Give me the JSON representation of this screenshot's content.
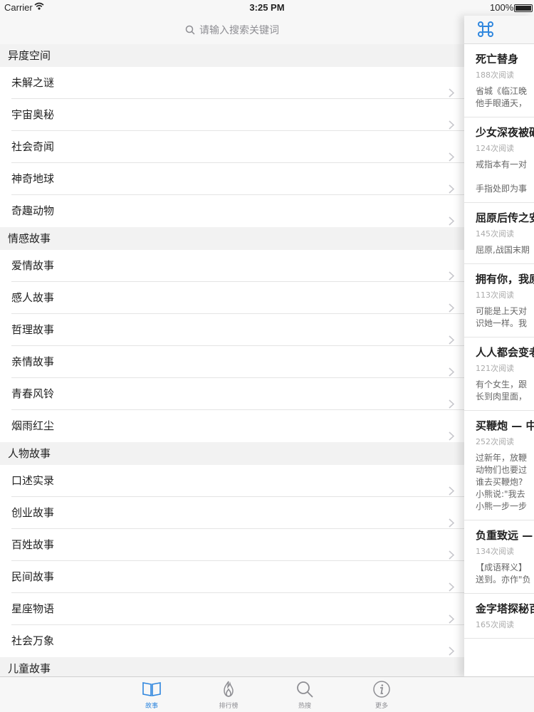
{
  "status_bar": {
    "carrier": "Carrier",
    "time": "3:25 PM",
    "battery": "100%"
  },
  "search": {
    "placeholder": "请输入搜索关键词"
  },
  "sections": [
    {
      "title": "异度空间",
      "items": [
        "未解之谜",
        "宇宙奥秘",
        "社会奇闻",
        "神奇地球",
        "奇趣动物"
      ]
    },
    {
      "title": "情感故事",
      "items": [
        "爱情故事",
        "感人故事",
        "哲理故事",
        "亲情故事",
        "青春风铃",
        "烟雨红尘"
      ]
    },
    {
      "title": "人物故事",
      "items": [
        "口述实录",
        "创业故事",
        "百姓故事",
        "民间故事",
        "星座物语",
        "社会万象"
      ]
    },
    {
      "title": "儿童故事",
      "items": []
    }
  ],
  "articles": [
    {
      "title": "死亡替身",
      "reads": "188次阅读",
      "excerpt": [
        "省城《临江晚",
        "他手眼通天，"
      ]
    },
    {
      "title": "少女深夜被砸",
      "reads": "124次阅读",
      "excerpt": [
        "戒指本有一对",
        "",
        "手指处即为事"
      ]
    },
    {
      "title": "屈原后传之安",
      "reads": "145次阅读",
      "excerpt": [
        "屈原,战国末期"
      ]
    },
    {
      "title": "拥有你，我原",
      "reads": "113次阅读",
      "excerpt": [
        "可能是上天对",
        "识她一样。我"
      ]
    },
    {
      "title": "人人都会变老",
      "reads": "121次阅读",
      "excerpt": [
        "有个女生，跟",
        "长到肉里面，"
      ]
    },
    {
      "title": "买鞭炮 — 中",
      "reads": "252次阅读",
      "excerpt": [
        "过新年，放鞭",
        "动物们也要过",
        "谁去买鞭炮?",
        "小熊说:\"我去",
        "小熊一步一步"
      ]
    },
    {
      "title": "负重致远 —",
      "reads": "134次阅读",
      "excerpt": [
        "【成语释义】",
        "送到。亦作\"负"
      ]
    },
    {
      "title": "金字塔探秘百",
      "reads": "165次阅读",
      "excerpt": []
    }
  ],
  "tabs": [
    {
      "label": "故事",
      "icon": "book-icon",
      "active": true
    },
    {
      "label": "排行榜",
      "icon": "flame-icon",
      "active": false
    },
    {
      "label": "热搜",
      "icon": "magnifier-icon",
      "active": false
    },
    {
      "label": "更多",
      "icon": "info-icon",
      "active": false
    }
  ],
  "colors": {
    "accent": "#2e86de",
    "inactive": "#8e8e93"
  }
}
